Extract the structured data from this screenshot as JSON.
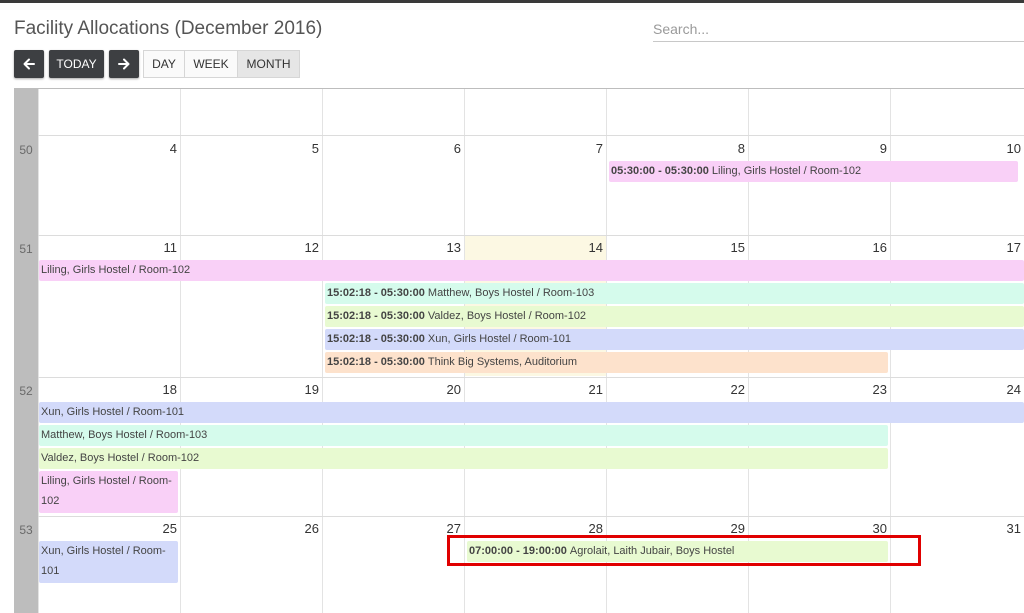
{
  "header": {
    "title": "Facility Allocations (December 2016)",
    "search_placeholder": "Search..."
  },
  "toolbar": {
    "today_label": "TODAY",
    "day_label": "DAY",
    "week_label": "WEEK",
    "month_label": "MONTH",
    "active_view": "MONTH"
  },
  "calendar": {
    "weeks": [
      {
        "number": "",
        "days": [
          "",
          "",
          "",
          "",
          "",
          "",
          ""
        ]
      },
      {
        "number": "50",
        "days": [
          "4",
          "5",
          "6",
          "7",
          "8",
          "9",
          "10"
        ]
      },
      {
        "number": "51",
        "days": [
          "11",
          "12",
          "13",
          "14",
          "15",
          "16",
          "17"
        ]
      },
      {
        "number": "52",
        "days": [
          "18",
          "19",
          "20",
          "21",
          "22",
          "23",
          "24"
        ]
      },
      {
        "number": "53",
        "days": [
          "25",
          "26",
          "27",
          "28",
          "29",
          "30",
          "31"
        ]
      }
    ],
    "today_date": "14",
    "events": [
      {
        "time": "05:30:00 - 05:30:00",
        "text": "Liling, Girls Hostel / Room-102",
        "color": "#f9d0f7"
      },
      {
        "time": "",
        "text": "Liling, Girls Hostel / Room-102",
        "color": "#f9d0f7"
      },
      {
        "time": "15:02:18 - 05:30:00",
        "text": "Matthew, Boys Hostel / Room-103",
        "color": "#d5fbec"
      },
      {
        "time": "15:02:18 - 05:30:00",
        "text": "Valdez, Boys Hostel / Room-102",
        "color": "#e8fad1"
      },
      {
        "time": "15:02:18 - 05:30:00",
        "text": "Xun, Girls Hostel / Room-101",
        "color": "#d3dafa"
      },
      {
        "time": "15:02:18 - 05:30:00",
        "text": "Think Big Systems, Auditorium",
        "color": "#fde2cc"
      },
      {
        "time": "",
        "text": "Xun, Girls Hostel / Room-101",
        "color": "#d3dafa"
      },
      {
        "time": "",
        "text": "Matthew, Boys Hostel / Room-103",
        "color": "#d5fbec"
      },
      {
        "time": "",
        "text": "Valdez, Boys Hostel / Room-102",
        "color": "#e8fad1"
      },
      {
        "time": "",
        "text": "Liling, Girls Hostel / Room-102",
        "color": "#f9d0f7"
      },
      {
        "time": "",
        "text": "Xun, Girls Hostel / Room-101",
        "color": "#d3dafa"
      },
      {
        "time": "07:00:00 - 19:00:00",
        "text": "Agrolait, Laith Jubair, Boys Hostel",
        "color": "#e8fad1"
      }
    ],
    "highlight_color": "#e00000"
  }
}
